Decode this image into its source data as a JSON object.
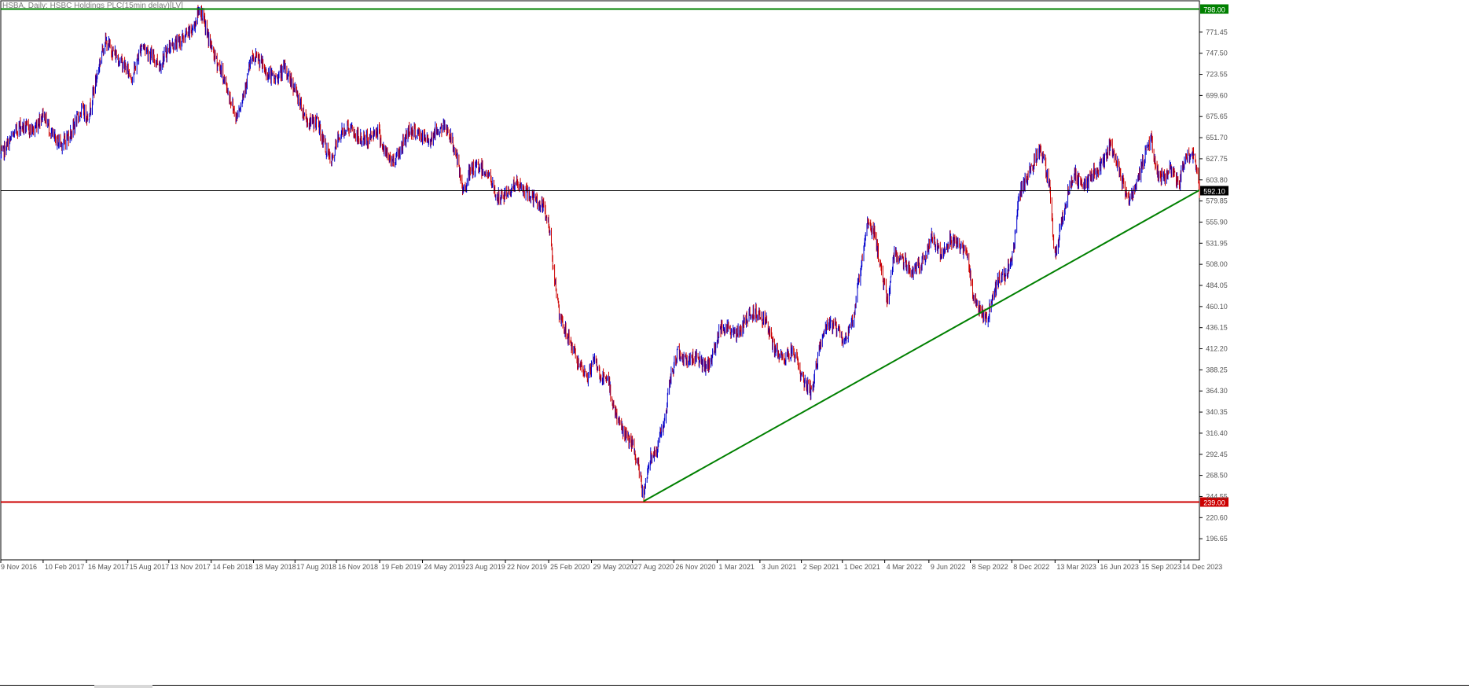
{
  "window": {
    "title": "HSBA, Daily: HSBC Holdings PLC(15min delay)[LV]"
  },
  "chart_data": {
    "type": "candlestick",
    "title": "HSBA, Daily: HSBC Holdings PLC(15min delay)[LV]",
    "xlabel": "",
    "ylabel": "",
    "ylim": [
      172.7,
      807.0
    ],
    "x_range": [
      "2016-11-09",
      "2024-01-24"
    ],
    "y_ticks": [
      "771.45",
      "747.50",
      "723.55",
      "699.60",
      "675.65",
      "651.70",
      "627.75",
      "603.80",
      "579.85",
      "555.90",
      "531.95",
      "508.00",
      "484.05",
      "460.10",
      "436.15",
      "412.20",
      "388.25",
      "364.30",
      "340.35",
      "316.40",
      "292.45",
      "268.50",
      "244.55",
      "220.60",
      "196.65"
    ],
    "x_ticks": [
      "9 Nov 2016",
      "10 Feb 2017",
      "16 May 2017",
      "15 Aug 2017",
      "13 Nov 2017",
      "14 Feb 2018",
      "18 May 2018",
      "17 Aug 2018",
      "16 Nov 2018",
      "19 Feb 2019",
      "24 May 2019",
      "23 Aug 2019",
      "22 Nov 2019",
      "25 Feb 2020",
      "29 May 2020",
      "27 Aug 2020",
      "26 Nov 2020",
      "1 Mar 2021",
      "3 Jun 2021",
      "2 Sep 2021",
      "1 Dec 2021",
      "4 Mar 2022",
      "9 Jun 2022",
      "8 Sep 2022",
      "8 Dec 2022",
      "13 Mar 2023",
      "16 Jun 2023",
      "15 Sep 2023",
      "14 Dec 2023"
    ],
    "grid": false,
    "up_color": "#0000cc",
    "down_color": "#cc0000",
    "price_path": [
      [
        "2016-11-09",
        630
      ],
      [
        "2016-11-25",
        645
      ],
      [
        "2016-12-20",
        665
      ],
      [
        "2017-01-20",
        660
      ],
      [
        "2017-02-10",
        680
      ],
      [
        "2017-03-05",
        650
      ],
      [
        "2017-03-25",
        645
      ],
      [
        "2017-04-15",
        660
      ],
      [
        "2017-05-05",
        683
      ],
      [
        "2017-05-20",
        675
      ],
      [
        "2017-06-05",
        715
      ],
      [
        "2017-06-25",
        762
      ],
      [
        "2017-07-15",
        748
      ],
      [
        "2017-08-05",
        735
      ],
      [
        "2017-08-25",
        720
      ],
      [
        "2017-09-15",
        758
      ],
      [
        "2017-10-05",
        745
      ],
      [
        "2017-10-25",
        735
      ],
      [
        "2017-11-15",
        755
      ],
      [
        "2017-12-10",
        762
      ],
      [
        "2018-01-05",
        775
      ],
      [
        "2018-01-20",
        800
      ],
      [
        "2018-02-05",
        770
      ],
      [
        "2018-02-20",
        745
      ],
      [
        "2018-03-10",
        725
      ],
      [
        "2018-03-25",
        700
      ],
      [
        "2018-04-10",
        675
      ],
      [
        "2018-04-25",
        700
      ],
      [
        "2018-05-12",
        738
      ],
      [
        "2018-05-28",
        742
      ],
      [
        "2018-06-15",
        725
      ],
      [
        "2018-07-05",
        718
      ],
      [
        "2018-07-25",
        730
      ],
      [
        "2018-08-10",
        715
      ],
      [
        "2018-08-25",
        695
      ],
      [
        "2018-09-15",
        668
      ],
      [
        "2018-10-05",
        670
      ],
      [
        "2018-10-20",
        645
      ],
      [
        "2018-11-05",
        622
      ],
      [
        "2018-11-20",
        652
      ],
      [
        "2018-12-10",
        665
      ],
      [
        "2019-01-05",
        650
      ],
      [
        "2019-01-25",
        650
      ],
      [
        "2019-02-15",
        662
      ],
      [
        "2019-03-01",
        635
      ],
      [
        "2019-03-20",
        625
      ],
      [
        "2019-04-05",
        638
      ],
      [
        "2019-04-25",
        662
      ],
      [
        "2019-05-15",
        655
      ],
      [
        "2019-06-05",
        648
      ],
      [
        "2019-06-25",
        660
      ],
      [
        "2019-07-15",
        665
      ],
      [
        "2019-08-05",
        635
      ],
      [
        "2019-08-20",
        590
      ],
      [
        "2019-09-05",
        612
      ],
      [
        "2019-09-25",
        620
      ],
      [
        "2019-10-15",
        610
      ],
      [
        "2019-11-05",
        582
      ],
      [
        "2019-11-25",
        588
      ],
      [
        "2019-12-15",
        600
      ],
      [
        "2020-01-05",
        590
      ],
      [
        "2020-01-25",
        582
      ],
      [
        "2020-02-10",
        575
      ],
      [
        "2020-02-25",
        555
      ],
      [
        "2020-03-10",
        490
      ],
      [
        "2020-03-20",
        445
      ],
      [
        "2020-04-05",
        430
      ],
      [
        "2020-04-20",
        410
      ],
      [
        "2020-05-05",
        388
      ],
      [
        "2020-05-20",
        380
      ],
      [
        "2020-06-05",
        400
      ],
      [
        "2020-06-20",
        378
      ],
      [
        "2020-07-05",
        375
      ],
      [
        "2020-07-20",
        340
      ],
      [
        "2020-08-05",
        320
      ],
      [
        "2020-08-15",
        312
      ],
      [
        "2020-08-28",
        300
      ],
      [
        "2020-09-08",
        280
      ],
      [
        "2020-09-20",
        245
      ],
      [
        "2020-10-05",
        290
      ],
      [
        "2020-10-20",
        300
      ],
      [
        "2020-11-05",
        330
      ],
      [
        "2020-11-20",
        382
      ],
      [
        "2020-12-05",
        410
      ],
      [
        "2020-12-25",
        398
      ],
      [
        "2021-01-15",
        405
      ],
      [
        "2021-02-05",
        388
      ],
      [
        "2021-02-20",
        405
      ],
      [
        "2021-03-10",
        440
      ],
      [
        "2021-03-25",
        435
      ],
      [
        "2021-04-15",
        428
      ],
      [
        "2021-05-05",
        448
      ],
      [
        "2021-05-25",
        455
      ],
      [
        "2021-06-15",
        445
      ],
      [
        "2021-07-05",
        410
      ],
      [
        "2021-07-25",
        400
      ],
      [
        "2021-08-15",
        412
      ],
      [
        "2021-09-05",
        378
      ],
      [
        "2021-09-25",
        362
      ],
      [
        "2021-10-10",
        410
      ],
      [
        "2021-10-25",
        436
      ],
      [
        "2021-11-15",
        440
      ],
      [
        "2021-12-05",
        420
      ],
      [
        "2021-12-25",
        446
      ],
      [
        "2022-01-10",
        505
      ],
      [
        "2022-01-25",
        555
      ],
      [
        "2022-02-10",
        545
      ],
      [
        "2022-03-01",
        485
      ],
      [
        "2022-03-10",
        468
      ],
      [
        "2022-03-25",
        520
      ],
      [
        "2022-04-15",
        512
      ],
      [
        "2022-05-05",
        500
      ],
      [
        "2022-05-25",
        508
      ],
      [
        "2022-06-15",
        540
      ],
      [
        "2022-07-05",
        520
      ],
      [
        "2022-07-25",
        538
      ],
      [
        "2022-08-15",
        530
      ],
      [
        "2022-09-01",
        520
      ],
      [
        "2022-09-15",
        470
      ],
      [
        "2022-10-01",
        455
      ],
      [
        "2022-10-15",
        445
      ],
      [
        "2022-10-25",
        468
      ],
      [
        "2022-11-10",
        492
      ],
      [
        "2022-11-25",
        495
      ],
      [
        "2022-12-10",
        520
      ],
      [
        "2022-12-25",
        590
      ],
      [
        "2023-01-10",
        605
      ],
      [
        "2023-01-25",
        625
      ],
      [
        "2023-02-10",
        638
      ],
      [
        "2023-03-01",
        600
      ],
      [
        "2023-03-12",
        515
      ],
      [
        "2023-03-25",
        550
      ],
      [
        "2023-04-10",
        588
      ],
      [
        "2023-04-25",
        610
      ],
      [
        "2023-05-15",
        595
      ],
      [
        "2023-06-05",
        612
      ],
      [
        "2023-06-25",
        620
      ],
      [
        "2023-07-10",
        645
      ],
      [
        "2023-07-25",
        625
      ],
      [
        "2023-08-10",
        598
      ],
      [
        "2023-08-25",
        580
      ],
      [
        "2023-09-10",
        600
      ],
      [
        "2023-09-25",
        632
      ],
      [
        "2023-10-10",
        650
      ],
      [
        "2023-10-25",
        610
      ],
      [
        "2023-11-10",
        605
      ],
      [
        "2023-11-25",
        618
      ],
      [
        "2023-12-10",
        598
      ],
      [
        "2023-12-25",
        628
      ],
      [
        "2024-01-10",
        635
      ],
      [
        "2024-01-24",
        592
      ]
    ],
    "horizontal_lines": [
      {
        "price": 798.0,
        "label": "798.00",
        "color": "#008000"
      },
      {
        "price": 592.1,
        "label": "592.10",
        "color": "#000000"
      },
      {
        "price": 239.0,
        "label": "239.00",
        "color": "#cc0000"
      }
    ],
    "trend_lines": [
      {
        "from": [
          "2020-09-20",
          239.0
        ],
        "to": [
          "2024-01-24",
          592.1
        ],
        "color": "#008000"
      }
    ]
  }
}
